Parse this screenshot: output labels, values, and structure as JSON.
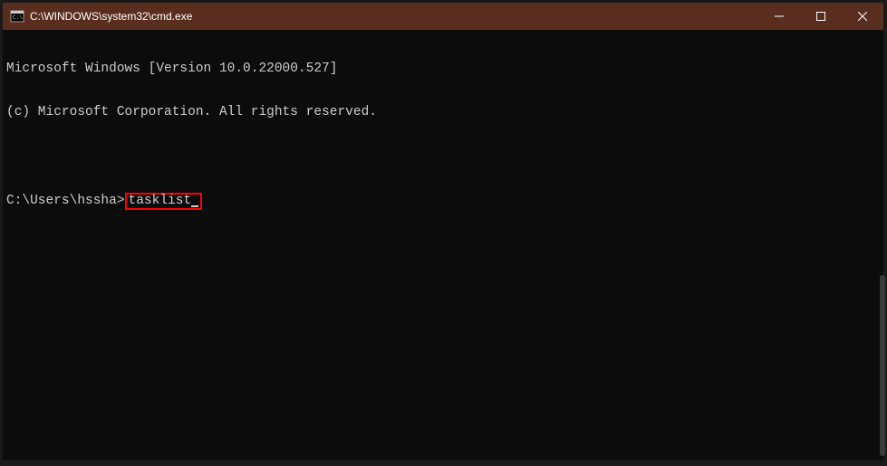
{
  "titlebar": {
    "title": "C:\\WINDOWS\\system32\\cmd.exe"
  },
  "terminal": {
    "line1": "Microsoft Windows [Version 10.0.22000.527]",
    "line2": "(c) Microsoft Corporation. All rights reserved.",
    "prompt": "C:\\Users\\hssha>",
    "command": "tasklist"
  }
}
